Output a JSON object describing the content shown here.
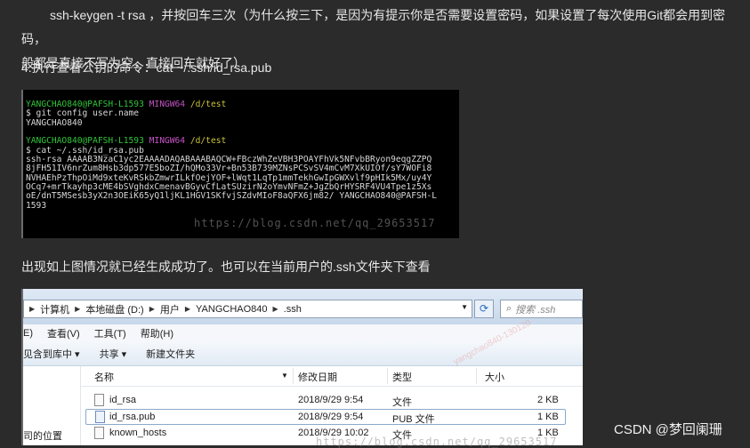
{
  "article": {
    "para1_line1": "ssh-keygen -t rsa ，并按回车三次（为什么按三下，是因为有提示你是否需要设置密码，如果设置了每次使用Git都会用到密码，",
    "para1_line2": "般都是直接不写为空，直接回车就好了）",
    "step4": "4.执行查看公钥的命令：cat ~/.ssh/id_rsa.pub",
    "note": "出现如上图情况就已经生成成功了。也可以在当前用户的.ssh文件夹下查看"
  },
  "terminal": {
    "prompt1": {
      "user": "YANGCHAO840@PAFSH-L1593",
      "env": "MINGW64",
      "path": "/d/test"
    },
    "cmd1": "$ git config user.name",
    "out1": "YANGCHAO840",
    "prompt2": {
      "user": "YANGCHAO840@PAFSH-L1593",
      "env": "MINGW64",
      "path": "/d/test"
    },
    "cmd2": "$ cat ~/.ssh/id_rsa.pub",
    "key_lines": [
      "ssh-rsa AAAAB3NzaC1yc2EAAAADAQABAAABAQCW+FBczWhZeVBH3POAYFhVk5NFvbBRyon9eqgZZPQ",
      "8jFH51IV6nrZum8Hsb3dp577E5boZI/hQMo33Vr+Bn53B739MZNsPCSvSV4mCvM7XkUIOf/sY7WOFi8",
      "NVHAEhPzThpOiMd9xteKvRSkbZmwrILkfOejYOF+lWqt1LqTp1mmTekhGwIpGWXvlf9pHIk5Mx/uy4Y",
      "OCq7+mrTkayhp3cME4bSVghdxCmenavBGyvCfLatSUzirN2oYmvNFmZ+JgZbQrHYSRF4VU4Tpe1z5Xs",
      "oE/dnT5MSesb3yX2n3OEiK65yQ1ljKL1HGV1SKfvjSZdvMIoF8aQFX6jm82/ YANGCHAO840@PAFSH-L",
      "1593"
    ],
    "watermark": "https://blog.csdn.net/qq_29653517"
  },
  "explorer": {
    "breadcrumbs": [
      "计算机",
      "本地磁盘 (D:)",
      "用户",
      "YANGCHAO840",
      ".ssh"
    ],
    "search_placeholder": "搜索 .ssh",
    "menu": [
      "E)",
      "查看(V)",
      "工具(T)",
      "帮助(H)"
    ],
    "toolbar": [
      "见含到库中 ▾",
      "共享 ▾",
      "新建文件夹"
    ],
    "columns": {
      "name": "名称",
      "date": "修改日期",
      "type": "类型",
      "size": "大小"
    },
    "files": [
      {
        "name": "id_rsa",
        "date": "2018/9/29 9:54",
        "type": "文件",
        "size": "2 KB",
        "selected": false
      },
      {
        "name": "id_rsa.pub",
        "date": "2018/9/29 9:54",
        "type": "PUB 文件",
        "size": "1 KB",
        "selected": true
      },
      {
        "name": "known_hosts",
        "date": "2018/9/29 10:02",
        "type": "文件",
        "size": "1 KB",
        "selected": false
      }
    ],
    "nav_label": "司的位置",
    "watermark": "https://blog.csdn.net/qq_29653517",
    "diag_watermark": "yangchao840-130120"
  },
  "footer": {
    "csdn_mark": "CSDN @梦回阑珊"
  }
}
